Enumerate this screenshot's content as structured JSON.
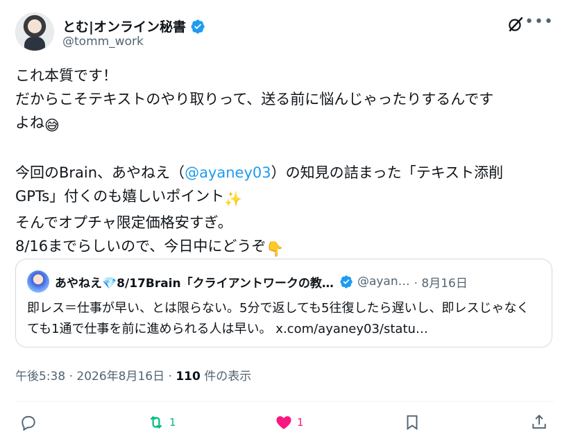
{
  "author": {
    "name": "とむ|オンライン秘書",
    "handle": "@tomm_work",
    "verified": true
  },
  "header_icons": [
    "grok-icon",
    "more-icon"
  ],
  "tweet": {
    "line1": "これ本質です！",
    "line2": "だからこそテキストのやり取りって、送る前に悩んじゃったりするんです",
    "line3": "よね",
    "line3_emoji": "😅",
    "line5a": "今回のBrain、あやねえ（",
    "mention": "@ayaney03",
    "line5b": "）の知見の詰まった「テキスト添削",
    "line6": "GPTs」付くのも嬉しいポイント",
    "line6_emoji": "✨",
    "line7": "そんでオプチャ限定価格安すぎ。",
    "line8": "8/16までらしいので、今日中にどうぞ",
    "line8_emoji": "👇"
  },
  "quote": {
    "name": "あやねえ💎8/17Brain「クライアントワークの教…",
    "handle": "@ayan…",
    "date": "· 8月16日",
    "body": "即レス＝仕事が早い、とは限らない。5分で返しても5往復したら遅いし、即レスじゃなくても1通で仕事を前に進められる人は早い。",
    "link": "x.com/ayaney03/statu…"
  },
  "meta": {
    "time": "午後5:38 · 2026年8月16日 · ",
    "views": "110",
    "views_label": " 件の表示"
  },
  "actions": {
    "reply_count": "",
    "retweet_count": "1",
    "like_count": "1"
  },
  "colors": {
    "accent": "#1d9bf0",
    "retweet": "#00ba7c",
    "like": "#f91880",
    "muted": "#536471"
  }
}
